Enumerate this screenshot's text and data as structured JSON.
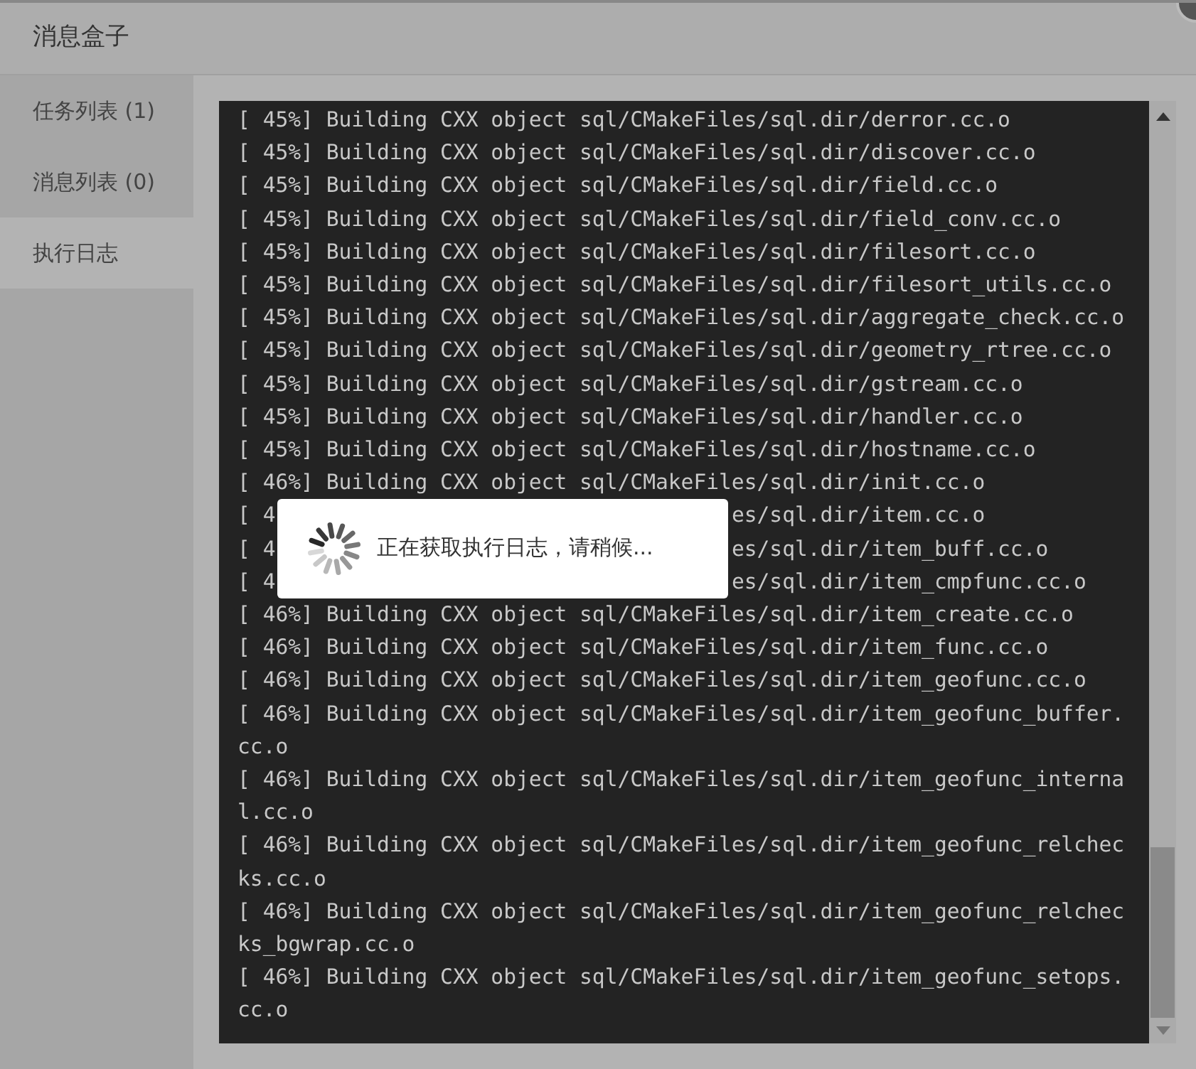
{
  "window": {
    "title": "消息盒子"
  },
  "tabs": [
    {
      "label": "任务列表 (1)",
      "selected": false
    },
    {
      "label": "消息列表 (0)",
      "selected": false
    },
    {
      "label": "执行日志",
      "selected": true
    }
  ],
  "log": {
    "lines": [
      {
        "kind": "full",
        "text": "[ 45%] Building CXX object sql/CMakeFiles/sql.dir/derror.cc.o"
      },
      {
        "kind": "full",
        "text": "[ 45%] Building CXX object sql/CMakeFiles/sql.dir/discover.cc.o"
      },
      {
        "kind": "full",
        "text": "[ 45%] Building CXX object sql/CMakeFiles/sql.dir/field.cc.o"
      },
      {
        "kind": "full",
        "text": "[ 45%] Building CXX object sql/CMakeFiles/sql.dir/field_conv.cc.o"
      },
      {
        "kind": "full",
        "text": "[ 45%] Building CXX object sql/CMakeFiles/sql.dir/filesort.cc.o"
      },
      {
        "kind": "full",
        "text": "[ 45%] Building CXX object sql/CMakeFiles/sql.dir/filesort_utils.cc.o"
      },
      {
        "kind": "full",
        "text": "[ 45%] Building CXX object sql/CMakeFiles/sql.dir/aggregate_check.cc.o"
      },
      {
        "kind": "full",
        "text": "[ 45%] Building CXX object sql/CMakeFiles/sql.dir/geometry_rtree.cc.o"
      },
      {
        "kind": "full",
        "text": "[ 45%] Building CXX object sql/CMakeFiles/sql.dir/gstream.cc.o"
      },
      {
        "kind": "full",
        "text": "[ 45%] Building CXX object sql/CMakeFiles/sql.dir/handler.cc.o"
      },
      {
        "kind": "full",
        "text": "[ 45%] Building CXX object sql/CMakeFiles/sql.dir/hostname.cc.o"
      },
      {
        "kind": "full",
        "text": "[ 46%] Building CXX object sql/CMakeFiles/sql.dir/init.cc.o"
      },
      {
        "kind": "covered",
        "left": "[ 4",
        "right": "es/sql.dir/item.cc.o"
      },
      {
        "kind": "covered",
        "left": "[ 4",
        "right": "es/sql.dir/item_buff.cc.o"
      },
      {
        "kind": "covered",
        "left": "[ 4",
        "right": "es/sql.dir/item_cmpfunc.cc.o"
      },
      {
        "kind": "full",
        "text": "[ 46%] Building CXX object sql/CMakeFiles/sql.dir/item_create.cc.o"
      },
      {
        "kind": "full",
        "text": "[ 46%] Building CXX object sql/CMakeFiles/sql.dir/item_func.cc.o"
      },
      {
        "kind": "full",
        "text": "[ 46%] Building CXX object sql/CMakeFiles/sql.dir/item_geofunc.cc.o"
      },
      {
        "kind": "full",
        "text": "[ 46%] Building CXX object sql/CMakeFiles/sql.dir/item_geofunc_buffer.cc.o"
      },
      {
        "kind": "full",
        "text": "[ 46%] Building CXX object sql/CMakeFiles/sql.dir/item_geofunc_internal.cc.o"
      },
      {
        "kind": "full",
        "text": "[ 46%] Building CXX object sql/CMakeFiles/sql.dir/item_geofunc_relchecks.cc.o"
      },
      {
        "kind": "full",
        "text": "[ 46%] Building CXX object sql/CMakeFiles/sql.dir/item_geofunc_relchecks_bgwrap.cc.o"
      },
      {
        "kind": "full",
        "text": "[ 46%] Building CXX object sql/CMakeFiles/sql.dir/item_geofunc_setops.cc.o"
      }
    ]
  },
  "loading": {
    "message": "正在获取执行日志，请稍候..."
  }
}
